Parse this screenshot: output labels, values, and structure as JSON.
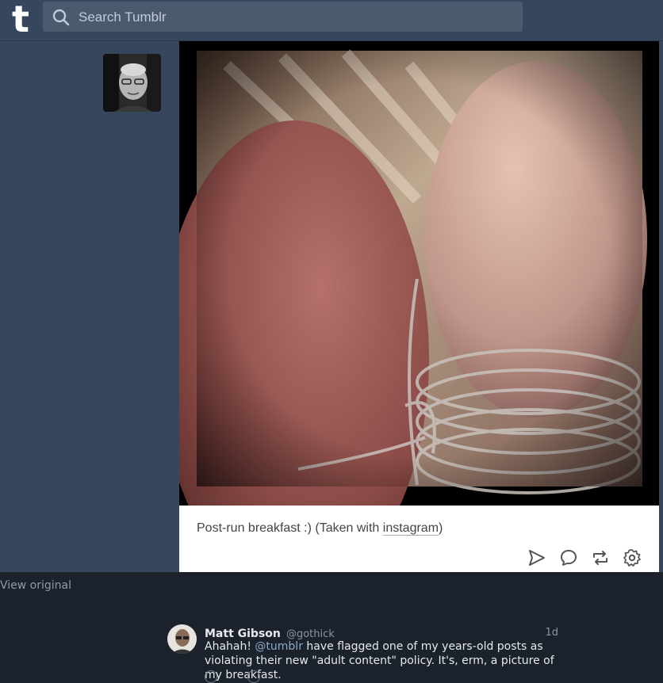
{
  "header": {
    "logo": "t",
    "search_placeholder": "Search Tumblr"
  },
  "post": {
    "caption_text": "Post-run breakfast :) (Taken with ",
    "caption_link": "instagram",
    "caption_end": ")",
    "actions": [
      "send-icon",
      "reply-icon",
      "reblog-icon",
      "settings-icon"
    ]
  },
  "view_original": "View original",
  "tweet": {
    "name": "Matt Gibson",
    "handle": "@gothick",
    "time": "1d",
    "text_start": "Ahahah! ",
    "mention": "@tumblr",
    "text_end": " have flagged one of my years-old posts as violating their new \"adult content\" policy. It's, erm, a picture of my breakfast."
  },
  "colors": {
    "tumblr_bg": "#36465d",
    "twitter_bg": "#1b222b",
    "mention": "#8ea9c4"
  }
}
